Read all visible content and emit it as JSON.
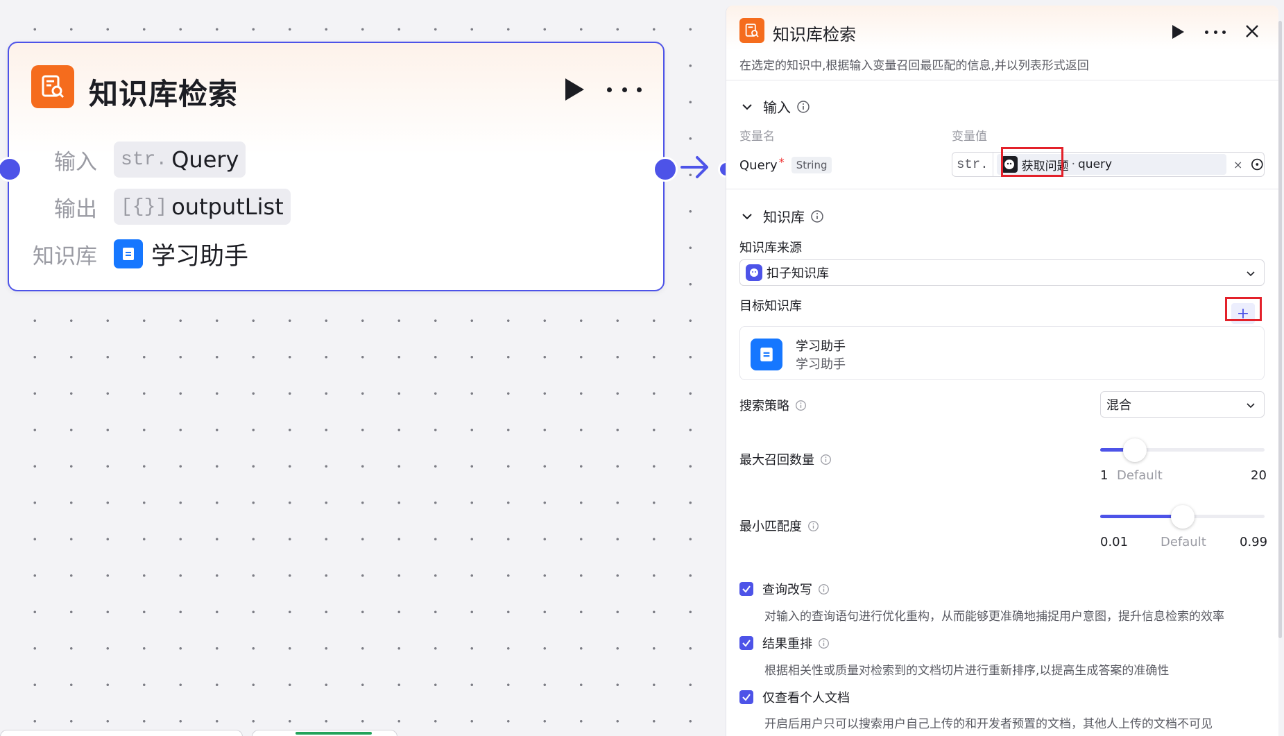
{
  "node": {
    "title": "知识库检索",
    "rows": [
      {
        "label": "输入",
        "tag": "str.",
        "value": "Query"
      },
      {
        "label": "输出",
        "tag": "[{}]",
        "value": "outputList"
      }
    ],
    "kb_label": "知识库",
    "kb_value": "学习助手"
  },
  "panel": {
    "title": "知识库检索",
    "description": "在选定的知识中,根据输入变量召回最匹配的信息,并以列表形式返回",
    "input_section": {
      "title": "输入",
      "col_name": "变量名",
      "col_value": "变量值",
      "var_name": "Query",
      "required_mark": "*",
      "var_type": "String",
      "value_type_tag": "str.",
      "ref_node": "获取问题",
      "ref_sep": "·",
      "ref_var": "query",
      "clear_glyph": "×"
    },
    "kb_section": {
      "title": "知识库",
      "source_label": "知识库来源",
      "source_value": "扣子知识库",
      "target_label": "目标知识库",
      "add_glyph": "+",
      "kb_name": "学习助手",
      "kb_desc": "学习助手"
    },
    "search_strategy": {
      "label": "搜索策略",
      "value": "混合"
    },
    "max_recall": {
      "label": "最大召回数量",
      "min": "1",
      "default": "Default",
      "max": "20",
      "value": 5
    },
    "min_match": {
      "label": "最小匹配度",
      "min": "0.01",
      "default": "Default",
      "max": "0.99",
      "value": 0.5
    },
    "options": [
      {
        "label": "查询改写",
        "checked": true,
        "has_info": true,
        "desc": "对输入的查询语句进行优化重构，从而能够更准确地捕捉用户意图，提升信息检索的效率"
      },
      {
        "label": "结果重排",
        "checked": true,
        "has_info": true,
        "desc": "根据相关性或质量对检索到的文档切片进行重新排序,以提高生成答案的准确性"
      },
      {
        "label": "仅查看个人文档",
        "checked": true,
        "has_info": false,
        "desc": "开启后用户只可以搜索用户自己上传的和开发者预置的文档，其他人上传的文档不可见"
      }
    ]
  },
  "colors": {
    "accent": "#4d53e8",
    "brand_orange": "#f56c1d",
    "doc_blue": "#1677ff",
    "highlight_red": "#e3212a"
  }
}
